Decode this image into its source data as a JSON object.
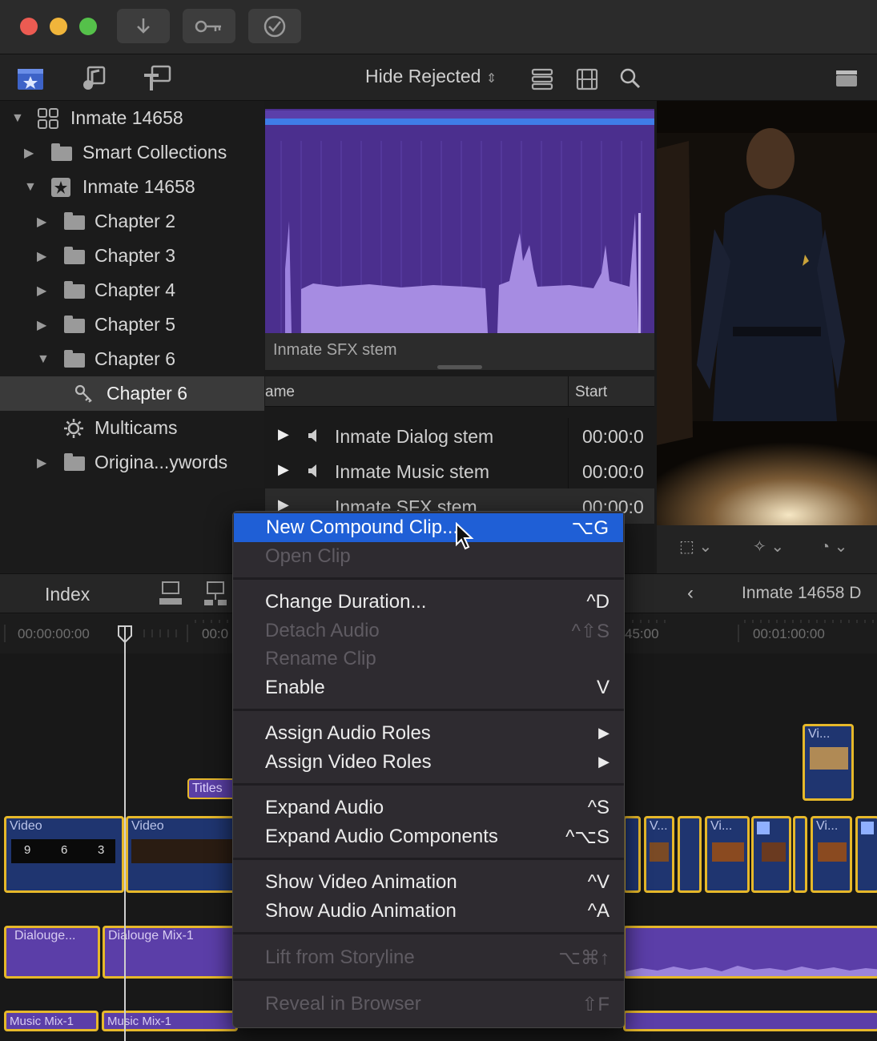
{
  "browser": {
    "hide_rejected": "Hide Rejected"
  },
  "library": {
    "items": [
      {
        "label": "Inmate 14658",
        "icon": "library-icon",
        "disclosure": "▼"
      },
      {
        "label": "Smart Collections",
        "icon": "folder-icon",
        "disclosure": "▶"
      },
      {
        "label": "Inmate 14658",
        "icon": "event-star-icon",
        "disclosure": "▼"
      },
      {
        "label": "Chapter 2",
        "icon": "folder-icon",
        "disclosure": "▶"
      },
      {
        "label": "Chapter 3",
        "icon": "folder-icon",
        "disclosure": "▶"
      },
      {
        "label": "Chapter 4",
        "icon": "folder-icon",
        "disclosure": "▶"
      },
      {
        "label": "Chapter 5",
        "icon": "folder-icon",
        "disclosure": "▶"
      },
      {
        "label": "Chapter 6",
        "icon": "folder-icon",
        "disclosure": "▼"
      },
      {
        "label": "Chapter 6",
        "icon": "keyword-icon",
        "disclosure": ""
      },
      {
        "label": "Multicams",
        "icon": "gear-icon",
        "disclosure": ""
      },
      {
        "label": "Origina...ywords",
        "icon": "folder-icon",
        "disclosure": "▶"
      }
    ]
  },
  "clip": {
    "filmstrip_label": "Inmate SFX stem",
    "columns": {
      "name": "ame",
      "start": "Start"
    },
    "rows": [
      {
        "name": "Inmate Dialog stem",
        "start": "00:00:0"
      },
      {
        "name": "Inmate Music stem",
        "start": "00:00:0"
      },
      {
        "name": "Inmate SFX stem",
        "start": "00:00:0"
      }
    ]
  },
  "timeline": {
    "index_label": "Index",
    "project_name": "Inmate 14658 D",
    "ruler": [
      "00:00:00:00",
      "00:0",
      "45:00",
      "00:01:00:00"
    ],
    "clips": {
      "video1": "Video",
      "video2": "Video",
      "titles": "Titles",
      "vi1": "Vi...",
      "v2": "V...",
      "vi3": "Vi...",
      "vi4": "Vi...",
      "dialog1": "Dialouge...",
      "dialog2": "Dialouge Mix-1",
      "music1": "Music Mix-1",
      "music2": "Music Mix-1",
      "counter": [
        "9",
        "6",
        "3"
      ]
    }
  },
  "menu": {
    "items": [
      {
        "label": "New Compound Clip...",
        "shortcut": "⌥G",
        "state": "highlight"
      },
      {
        "label": "Open Clip",
        "shortcut": "",
        "state": "disabled"
      },
      {
        "label": "Change Duration...",
        "shortcut": "^D",
        "state": "enabled"
      },
      {
        "label": "Detach Audio",
        "shortcut": "^⇧S",
        "state": "disabled"
      },
      {
        "label": "Rename Clip",
        "shortcut": "",
        "state": "disabled"
      },
      {
        "label": "Enable",
        "shortcut": "V",
        "state": "enabled"
      },
      {
        "label": "Assign Audio Roles",
        "shortcut": "▶",
        "state": "enabled"
      },
      {
        "label": "Assign Video Roles",
        "shortcut": "▶",
        "state": "enabled"
      },
      {
        "label": "Expand Audio",
        "shortcut": "^S",
        "state": "enabled"
      },
      {
        "label": "Expand Audio Components",
        "shortcut": "^⌥S",
        "state": "enabled"
      },
      {
        "label": "Show Video Animation",
        "shortcut": "^V",
        "state": "enabled"
      },
      {
        "label": "Show Audio Animation",
        "shortcut": "^A",
        "state": "enabled"
      },
      {
        "label": "Lift from Storyline",
        "shortcut": "⌥⌘↑",
        "state": "disabled"
      },
      {
        "label": "Reveal in Browser",
        "shortcut": "⇧F",
        "state": "disabled"
      }
    ]
  },
  "colors": {
    "accent_blue": "#1f5fd6",
    "clip_border": "#e6b82a",
    "audio_clip": "#5b3ea8",
    "video_clip": "#1f3570"
  }
}
